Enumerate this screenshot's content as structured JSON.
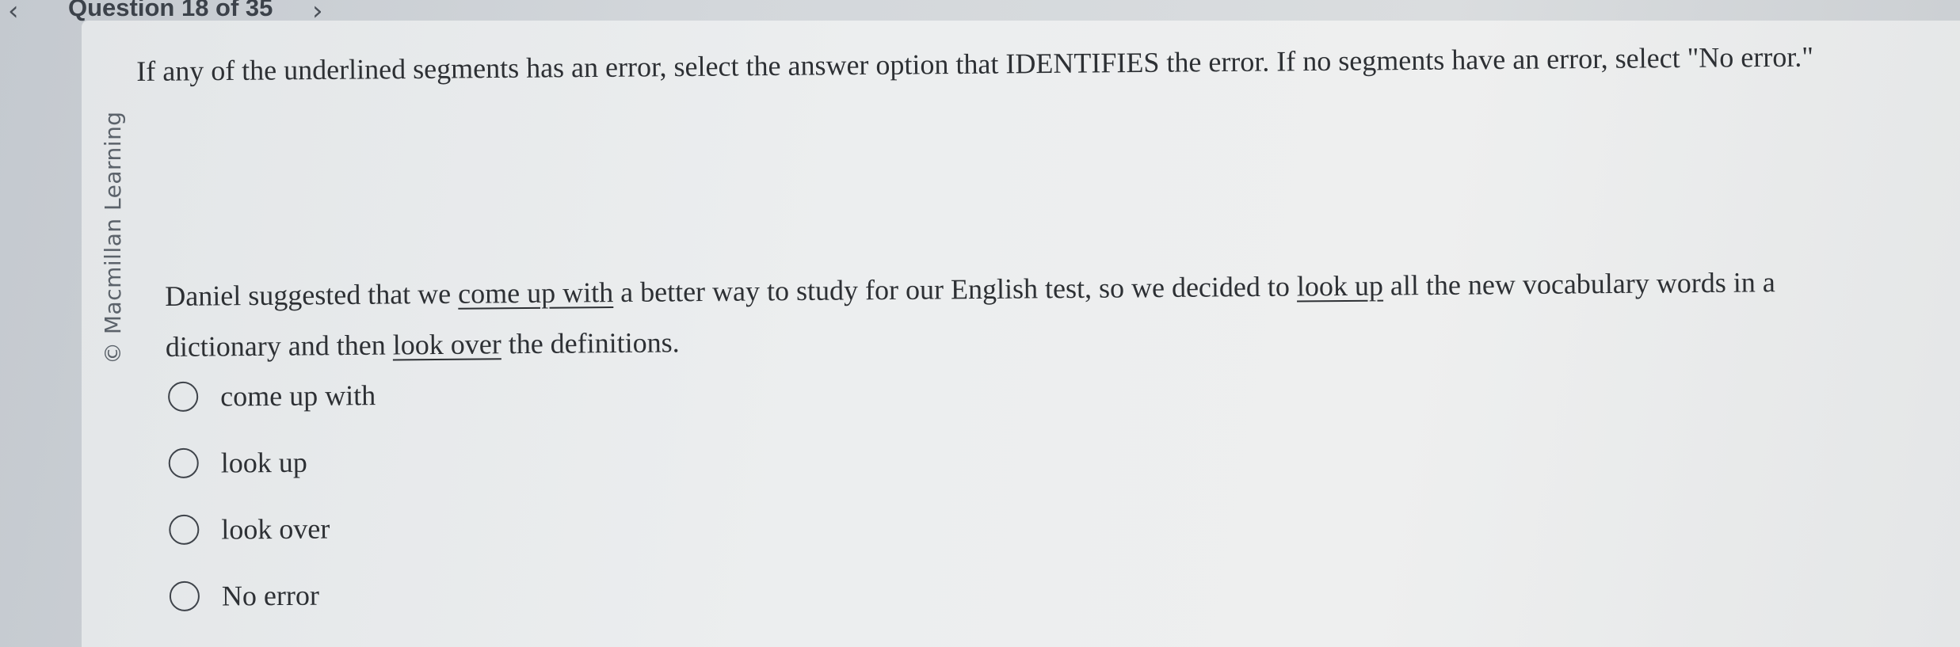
{
  "header": {
    "prev_icon": "chevron-left-icon",
    "prev_glyph": "‹",
    "question_counter": "Question 18 of 35",
    "next_icon": "chevron-right-icon",
    "next_glyph": "›"
  },
  "watermark": {
    "copyright": "© Macmillan Learning"
  },
  "question": {
    "instructions": "If any of the underlined segments has an error, select the answer option that IDENTIFIES the error. If no segments have an error, select \"No error.\"",
    "passage": {
      "part1": "Daniel suggested that we ",
      "seg1": "come up with",
      "part2": " a better way to study for our English test, so we decided to ",
      "seg2": "look up",
      "part3": " all the new vocabulary words in a dictionary and then ",
      "seg3": "look over",
      "part4": " the definitions."
    },
    "options": [
      {
        "label": "come up with",
        "selected": false
      },
      {
        "label": "look up",
        "selected": false
      },
      {
        "label": "look over",
        "selected": false
      },
      {
        "label": "No error",
        "selected": false
      }
    ]
  },
  "colors": {
    "text": "#2d3034",
    "radio_border": "#3e434a",
    "card_background": "#eceeef",
    "page_background": "#d3d7db"
  }
}
